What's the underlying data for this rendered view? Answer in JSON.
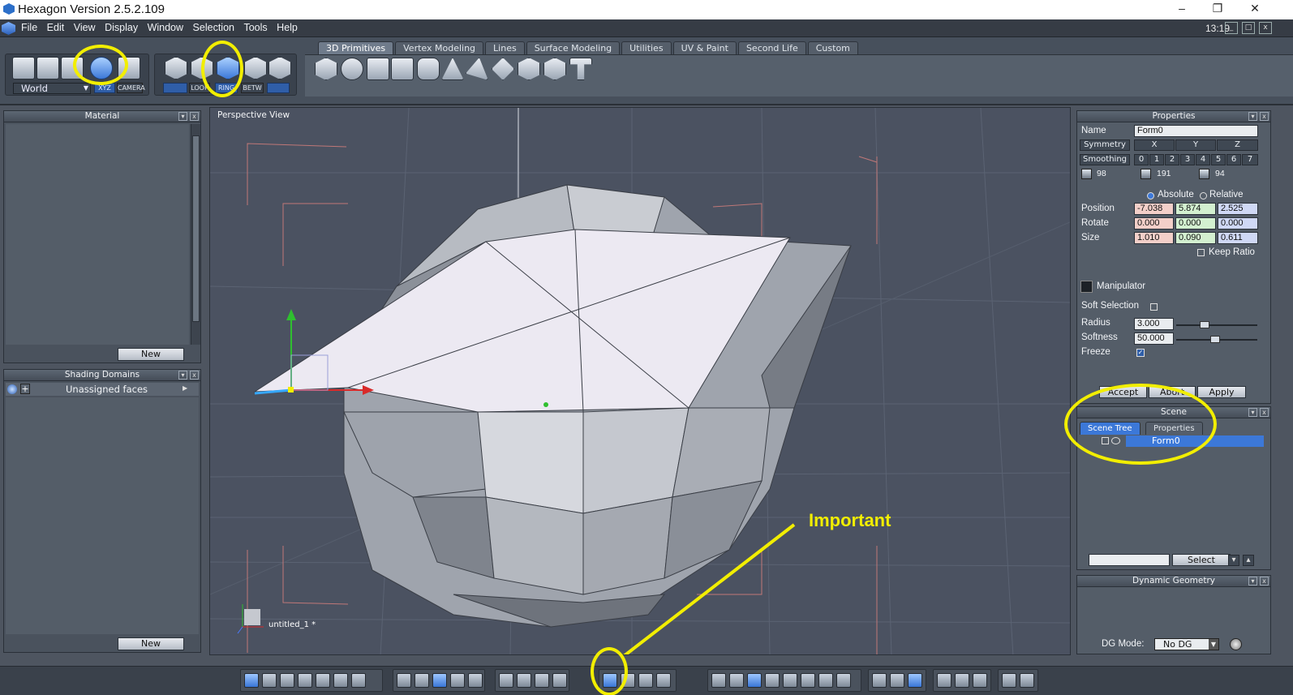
{
  "app": {
    "title": "Hexagon Version 2.5.2.109",
    "clock": "13:19"
  },
  "window_buttons": {
    "minimize": "–",
    "maximize": "❐",
    "close": "✕"
  },
  "menu": [
    "File",
    "Edit",
    "View",
    "Display",
    "Window",
    "Selection",
    "Tools",
    "Help"
  ],
  "toolbar": {
    "coord_mode": "World",
    "small_labels": {
      "xyz": "XYZ",
      "camera": "CAMERA",
      "loop": "LOOP",
      "ring": "RING",
      "betw": "BETW"
    },
    "tabs": [
      "3D Primitives",
      "Vertex Modeling",
      "Lines",
      "Surface Modeling",
      "Utilities",
      "UV & Paint",
      "Second Life",
      "Custom"
    ],
    "active_tab": "3D Primitives"
  },
  "panels": {
    "material": {
      "title": "Material",
      "new_label": "New"
    },
    "shading": {
      "title": "Shading Domains",
      "item": "Unassigned faces",
      "new_label": "New"
    }
  },
  "viewport": {
    "label": "Perspective View",
    "filename": "untitled_1 *",
    "annotation": "Important"
  },
  "properties": {
    "title": "Properties",
    "name_label": "Name",
    "name_value": "Form0",
    "symmetry_label": "Symmetry",
    "axes": [
      "X",
      "Y",
      "Z"
    ],
    "smoothing_label": "Smoothing",
    "smoothing_levels": [
      "0",
      "1",
      "2",
      "3",
      "4",
      "5",
      "6",
      "7"
    ],
    "counts": {
      "vertices": "98",
      "edges": "191",
      "faces": "94"
    },
    "absolute_label": "Absolute",
    "relative_label": "Relative",
    "position_label": "Position",
    "position": [
      "-7.038",
      "5.874",
      "2.525"
    ],
    "rotate_label": "Rotate",
    "rotate": [
      "0.000",
      "0.000",
      "0.000"
    ],
    "size_label": "Size",
    "size": [
      "1.010",
      "0.090",
      "0.611"
    ],
    "keep_ratio_label": "Keep Ratio",
    "manipulator_label": "Manipulator",
    "soft_selection_label": "Soft Selection",
    "radius_label": "Radius",
    "radius": "3.000",
    "softness_label": "Softness",
    "softness": "50.000",
    "freeze_label": "Freeze",
    "accept_label": "Accept",
    "abort_label": "Abort",
    "apply_label": "Apply"
  },
  "scene": {
    "title": "Scene",
    "tabs": [
      "Scene Tree",
      "Properties"
    ],
    "item": "Form0",
    "select_label": "Select"
  },
  "dynamic_geometry": {
    "title": "Dynamic Geometry",
    "dg_mode_label": "DG Mode:",
    "dg_mode_value": "No DG"
  },
  "colors": {
    "highlight": "#f2ee00",
    "selection": "#3c78d8",
    "panel": "#545d68"
  }
}
